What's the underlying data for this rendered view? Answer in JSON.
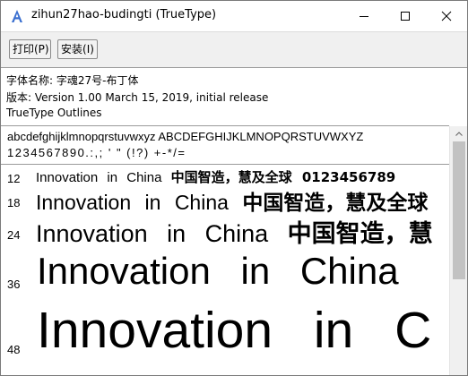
{
  "window": {
    "title": "zihun27hao-budingti (TrueType)"
  },
  "toolbar": {
    "print_label": "打印(P)",
    "install_label": "安装(I)"
  },
  "info": {
    "font_name_line": "字体名称: 字魂27号-布丁体",
    "version_line": "版本: Version 1.00 March 15, 2019, initial release",
    "outline_line": "TrueType Outlines"
  },
  "charset": {
    "latin": "abcdefghijklmnopqrstuvwxyz  ABCDEFGHIJKLMNOPQRSTUVWXYZ",
    "digits": "1234567890.:,; ' \"  (!?)  +-*/="
  },
  "samples": {
    "rows": [
      {
        "size": "12",
        "latin": "Innovation in China ",
        "cjk": "中国智造，慧及全球 0123456789"
      },
      {
        "size": "18",
        "latin": "Innovation in China ",
        "cjk": "中国智造，慧及全球"
      },
      {
        "size": "24",
        "latin": "Innovation in China ",
        "cjk": "中国智造，慧"
      },
      {
        "size": "36",
        "latin": "Innovation in China",
        "cjk": ""
      },
      {
        "size": "48",
        "latin": "Innovation in C",
        "cjk": ""
      }
    ]
  },
  "icons": {
    "app": "font-viewer-icon",
    "minimize": "minimize-icon",
    "maximize": "maximize-icon",
    "close": "close-icon",
    "scroll_up": "chevron-up-icon"
  },
  "colors": {
    "toolbar_bg": "#f0f0f0",
    "scroll_thumb": "#c2c2c2",
    "app_icon_blue": "#3a6fd0"
  }
}
